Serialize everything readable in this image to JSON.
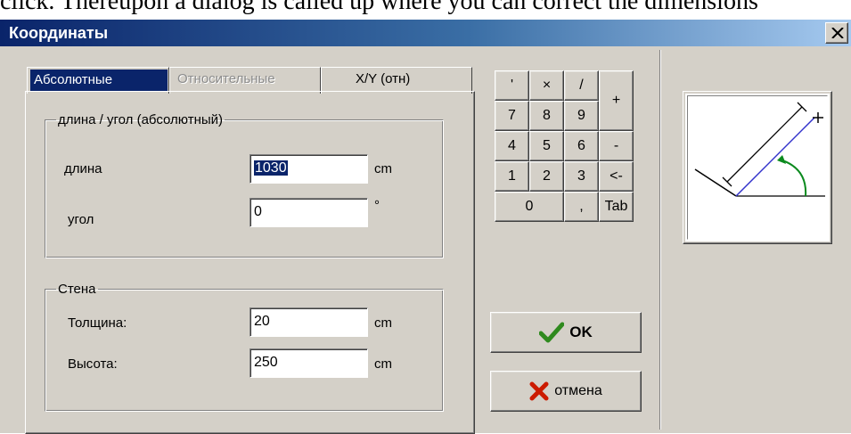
{
  "caption_text": "click. Thereupon a dialog is called up where you can correct the dimensions",
  "window": {
    "title": "Координаты"
  },
  "tabs": [
    {
      "label": "Абсолютные",
      "active": true,
      "enabled": true
    },
    {
      "label": "Относительные",
      "active": false,
      "enabled": false
    },
    {
      "label": "X/Y (отн)",
      "active": false,
      "enabled": true
    }
  ],
  "group_length_angle": {
    "legend": "длина / угол (абсолютный)",
    "length_label": "длина",
    "length_value": "1030",
    "length_unit": "cm",
    "angle_label": "угол",
    "angle_value": "0",
    "angle_unit": "°"
  },
  "group_wall": {
    "legend": "Стена",
    "thickness_label": "Толщина:",
    "thickness_value": "20",
    "thickness_unit": "cm",
    "height_label": "Высота:",
    "height_value": "250",
    "height_unit": "cm"
  },
  "keypad": {
    "keys": [
      "'",
      "×",
      "/",
      "+",
      "7",
      "8",
      "9",
      "4",
      "5",
      "6",
      "-",
      "1",
      "2",
      "3",
      "<-",
      "0",
      ",",
      "Tab"
    ]
  },
  "buttons": {
    "ok": "OK",
    "cancel": "отмена"
  },
  "colors": {
    "face": "#d4d0c8",
    "title_start": "#0a246a",
    "title_end": "#a6caf0",
    "selection": "#0a246a",
    "ok_check": "#2f8a1e",
    "cancel_x": "#cc1b00",
    "preview_line": "#3333cc",
    "preview_arrow": "#0b8a1e"
  }
}
